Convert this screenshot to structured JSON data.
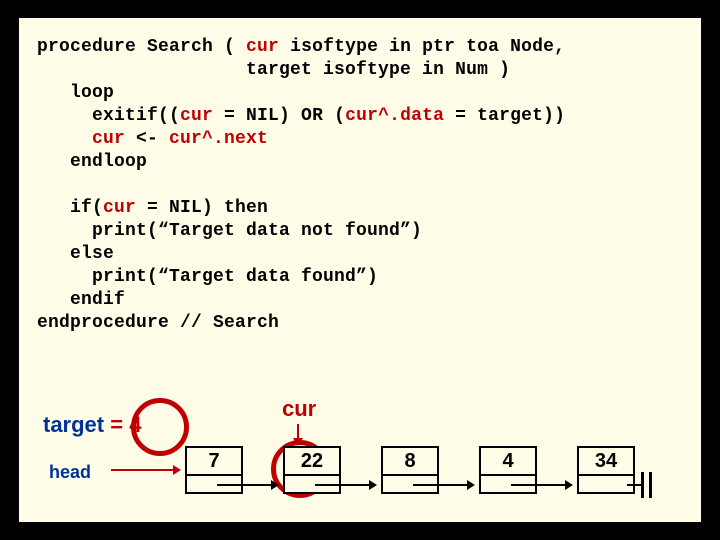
{
  "code": {
    "line1a": "procedure Search ( ",
    "line1b": "cur",
    "line1c": " isoftype in ptr toa Node,",
    "line2": "                   target isoftype in Num )",
    "line3": "   loop",
    "line4a": "     exitif((",
    "line4b": "cur",
    "line4c": " = NIL) OR (",
    "line4d": "cur^.data",
    "line4e": " = target))",
    "line5a": "     ",
    "line5b": "cur",
    "line5c": " <- ",
    "line5d": "cur^.next",
    "line6": "   endloop",
    "blank1": "",
    "line7a": "   if(",
    "line7b": "cur",
    "line7c": " = NIL) then",
    "line8": "     print(“Target data not found”)",
    "line9": "   else",
    "line10": "     print(“Target data found”)",
    "line11": "   endif",
    "line12": "endprocedure // Search"
  },
  "diagram": {
    "target_label": "target",
    "target_eq": " = 4",
    "cur_label": "cur",
    "head_label": "head",
    "nodes": [
      "7",
      "22",
      "8",
      "4",
      "34"
    ],
    "cur_index": 1,
    "target_value": 4
  }
}
